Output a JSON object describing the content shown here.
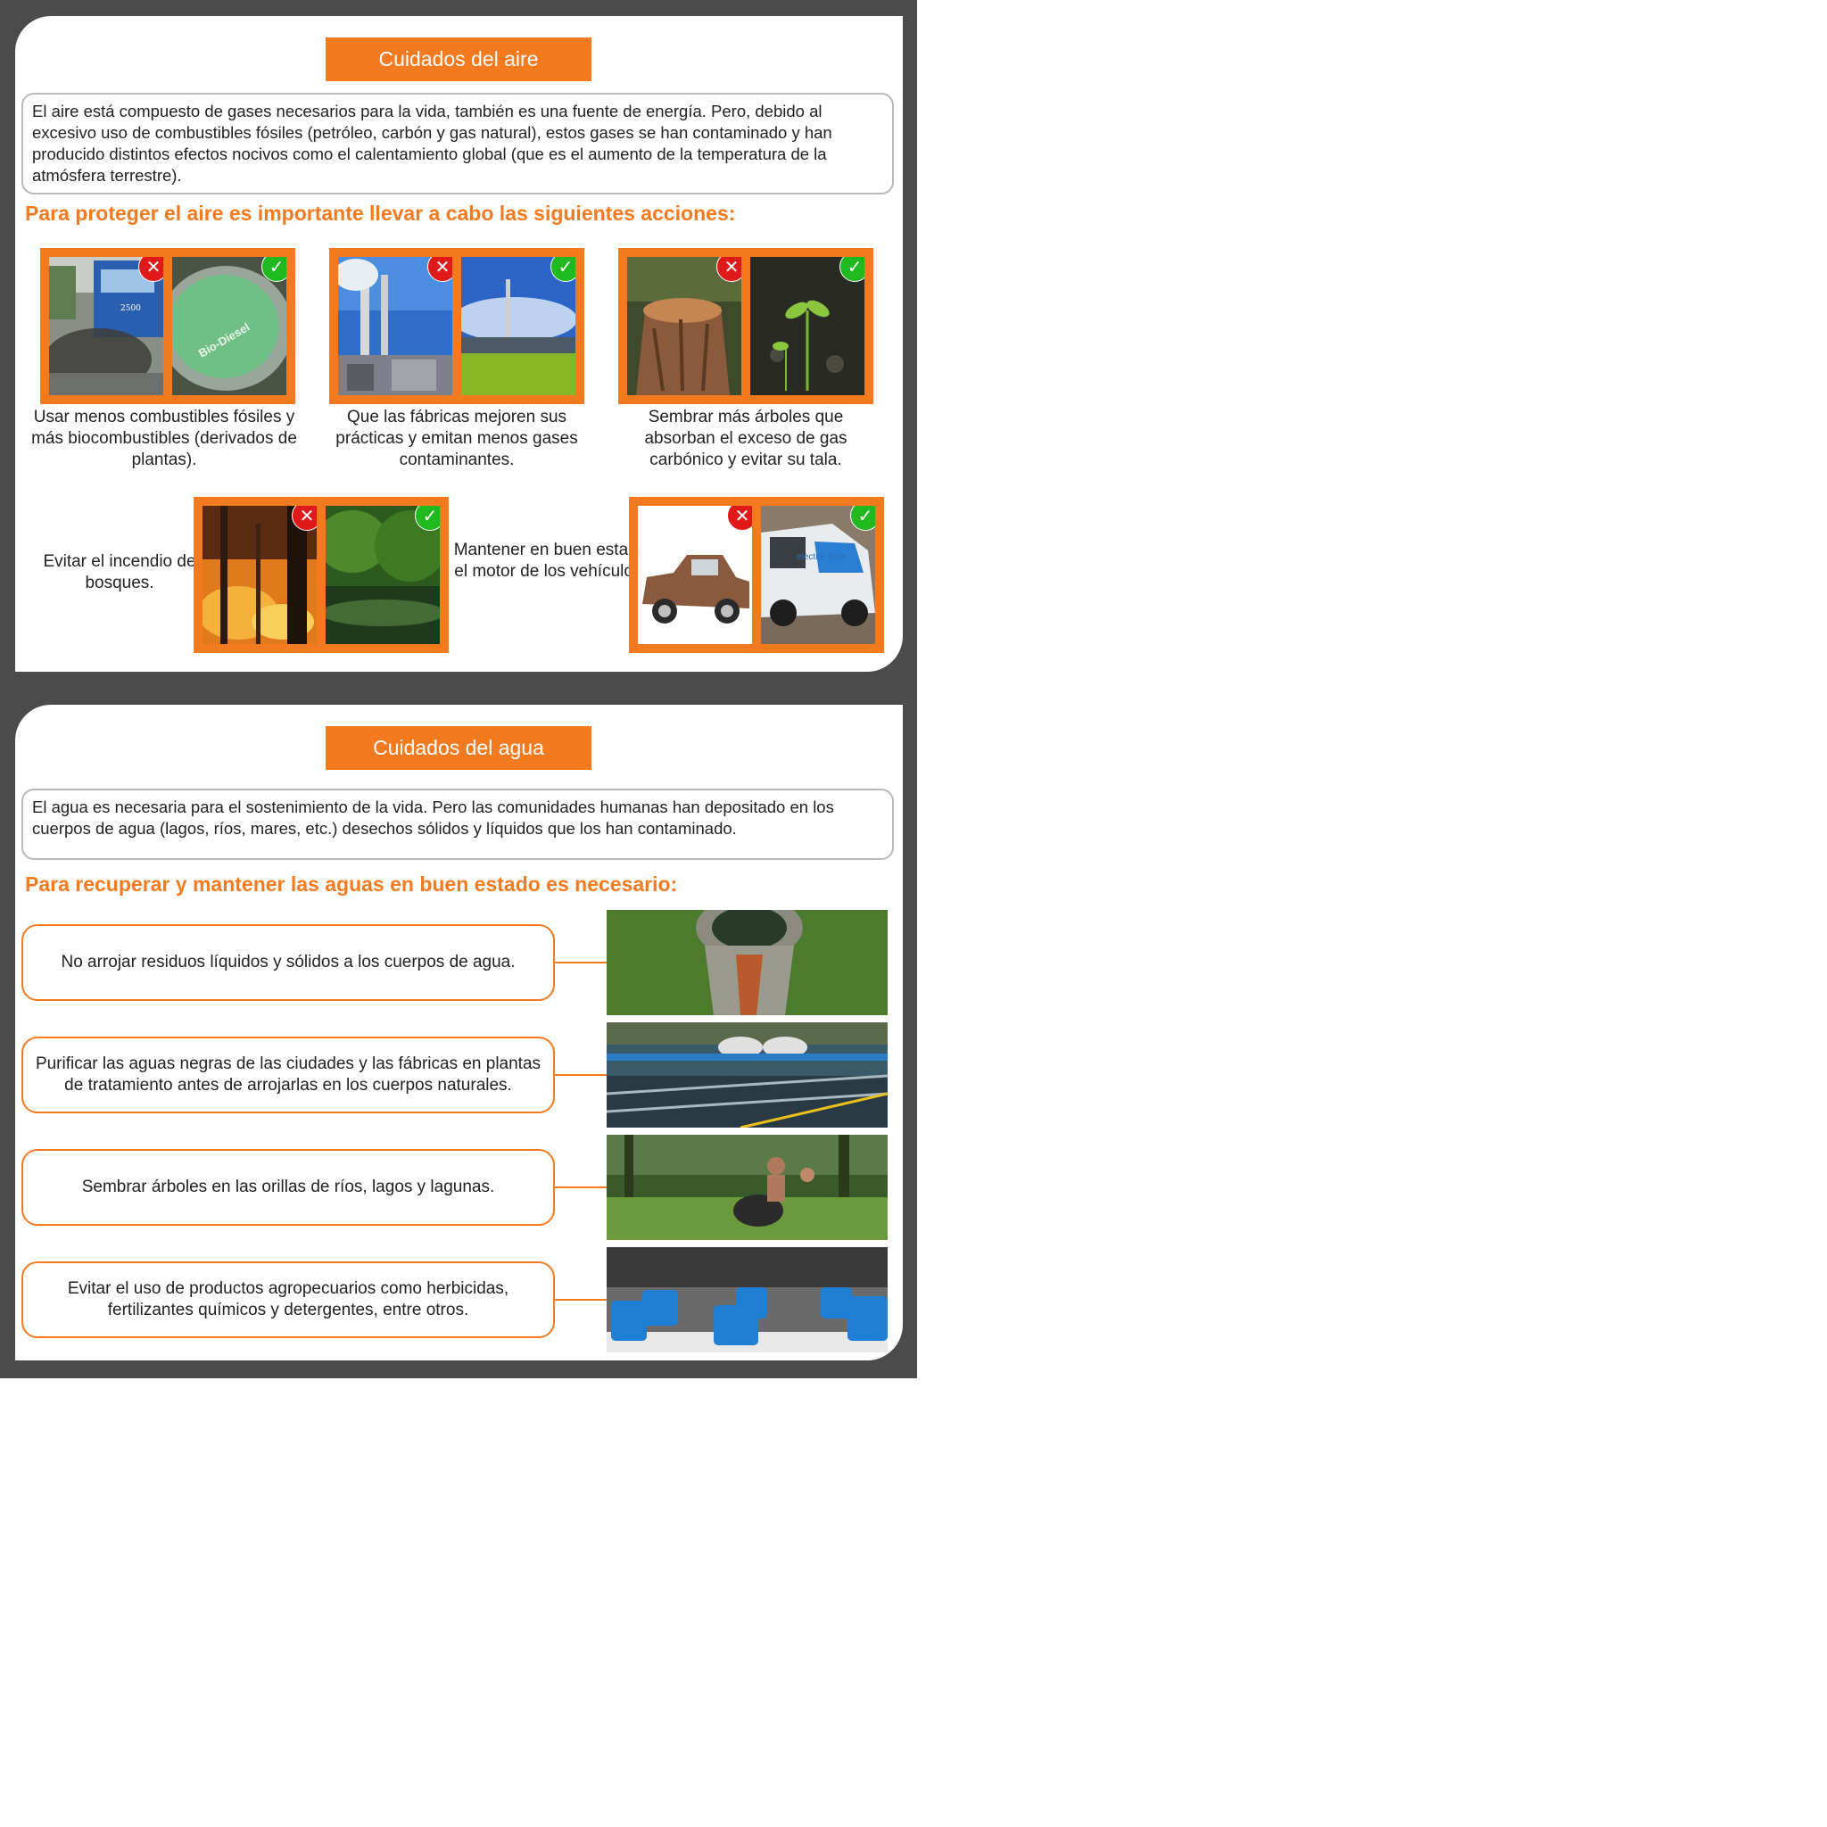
{
  "air": {
    "title": "Cuidados del aire",
    "intro": "El aire está compuesto de gases necesarios para la vida, también es una fuente de energía. Pero, debido al excesivo uso de combustibles fósiles (petróleo, carbón y gas natural), estos gases se han contaminado y han producido distintos efectos nocivos como el calentamiento global (que es el aumento de la temperatura de la atmósfera terrestre).",
    "subtitle": "Para proteger el aire es importante llevar a cabo las siguientes acciones:",
    "actions": [
      {
        "caption": "Usar menos combustibles fósiles y más biocombustibles (derivados de plantas).",
        "bad_label": "2500",
        "good_label": "Bio-Diesel"
      },
      {
        "caption": "Que las fábricas mejoren sus prácticas y emitan menos gases contaminantes."
      },
      {
        "caption": "Sembrar más árboles que absorban el exceso de gas carbónico y evitar su tala."
      },
      {
        "caption": "Evitar el incendio de bosques."
      },
      {
        "caption": "Mantener en buen estado el motor de los vehículos.",
        "good_label": "electric drive"
      }
    ],
    "badges": {
      "bad": "✕",
      "good": "✓"
    }
  },
  "water": {
    "title": "Cuidados del agua",
    "intro": "El agua es necesaria para el sostenimiento de la vida. Pero las comunidades humanas han depositado en los cuerpos de agua (lagos, ríos, mares, etc.) desechos sólidos y líquidos que los han contaminado.",
    "subtitle": "Para recuperar y mantener las aguas en buen estado es necesario:",
    "items": [
      "No arrojar residuos líquidos y sólidos a los cuerpos de agua.",
      "Purificar las aguas negras de las ciudades y las fábricas en plantas de tratamiento antes de arrojarlas en los cuerpos naturales.",
      "Sembrar árboles en las orillas de ríos, lagos y lagunas.",
      "Evitar el uso de productos agropecuarios como herbicidas, fertilizantes químicos y detergentes, entre otros."
    ]
  },
  "colors": {
    "accent": "#f47a1f",
    "frame": "#4b4b4b",
    "bad": "#e01a1a",
    "good": "#20b91f"
  }
}
